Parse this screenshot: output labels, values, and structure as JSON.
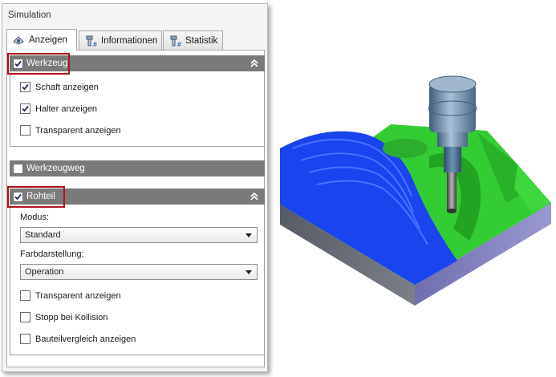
{
  "panel": {
    "title": "Simulation"
  },
  "tabs": [
    {
      "label": "Anzeigen",
      "icon": "eye-view-icon",
      "active": true
    },
    {
      "label": "Informationen",
      "icon": "tool-info-icon",
      "active": false
    },
    {
      "label": "Statistik",
      "icon": "tool-statistics-icon",
      "active": false
    }
  ],
  "sections": {
    "werkzeug": {
      "label": "Werkzeug",
      "checked": true,
      "expanded": true,
      "options": [
        {
          "label": "Schaft anzeigen",
          "checked": true
        },
        {
          "label": "Halter anzeigen",
          "checked": true
        },
        {
          "label": "Transparent anzeigen",
          "checked": false
        }
      ]
    },
    "werkzeugweg": {
      "label": "Werkzeugweg",
      "checked": false,
      "expanded": false
    },
    "rohteil": {
      "label": "Rohteil",
      "checked": true,
      "expanded": true,
      "modus_label": "Modus:",
      "modus_value": "Standard",
      "farb_label": "Farbdarstellung:",
      "farb_value": "Operation",
      "options": [
        {
          "label": "Transparent anzeigen",
          "checked": false
        },
        {
          "label": "Stopp bei Kollision",
          "checked": false
        },
        {
          "label": "Bauteilvergleich anzeigen",
          "checked": false
        }
      ]
    }
  },
  "colors": {
    "header_gray": "#7a7a7a",
    "highlight_red": "#b0121b",
    "stock_green": "#33cc33",
    "toolpath_blue": "#1a44ee",
    "tool_steel": "#6b8aa8"
  }
}
